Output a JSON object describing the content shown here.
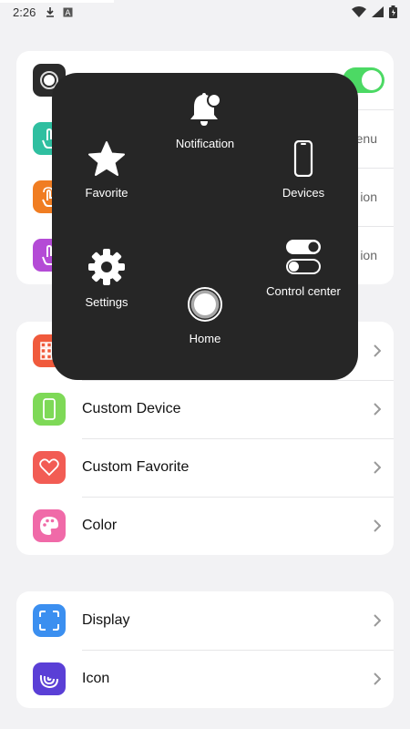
{
  "status_bar": {
    "time": "2:26",
    "icons": [
      "download-icon",
      "text-a-icon",
      "wifi-icon",
      "signal-icon",
      "battery-icon"
    ]
  },
  "top_card": {
    "rows": [
      {
        "partial_text": "",
        "toggle_on": true,
        "icon": "assistive-touch-icon",
        "color": "#2b2b2b"
      },
      {
        "partial_text": "enu",
        "icon": "single-tap-icon",
        "color": "#2fbfa0"
      },
      {
        "partial_text": "ion",
        "icon": "double-tap-icon",
        "color": "#f07d22"
      },
      {
        "partial_text": "ion",
        "icon": "long-press-icon",
        "color": "#b44bd6"
      }
    ]
  },
  "custom_card": {
    "rows": [
      {
        "label": "",
        "icon": "grid-icon",
        "color": "#f05a3c"
      },
      {
        "label": "Custom Device",
        "icon": "phone-icon",
        "color": "#7ed957"
      },
      {
        "label": "Custom Favorite",
        "icon": "heart-icon",
        "color": "#f25c54"
      },
      {
        "label": "Color",
        "icon": "palette-icon",
        "color": "#f06aa8"
      }
    ]
  },
  "display_card": {
    "rows": [
      {
        "label": "Display",
        "icon": "frame-icon",
        "color": "#3b8ff0"
      },
      {
        "label": "Icon",
        "icon": "swirl-icon",
        "color": "#5a3fd6"
      }
    ]
  },
  "assist_menu": {
    "notification": "Notification",
    "favorite": "Favorite",
    "devices": "Devices",
    "settings": "Settings",
    "control_center": "Control center",
    "home": "Home"
  }
}
